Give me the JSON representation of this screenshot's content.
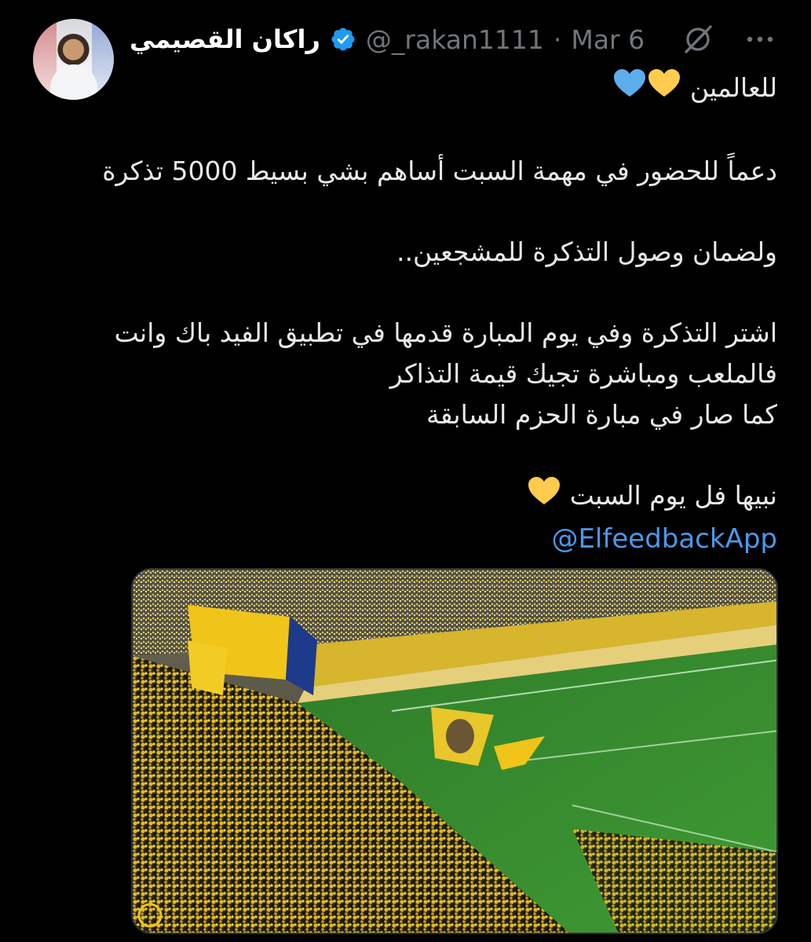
{
  "tweet": {
    "author": {
      "display_name": "راكان القصيمي",
      "handle": "@_rakan1111",
      "verified": true
    },
    "separator": "·",
    "date": "Mar 6",
    "icons": [
      "grok-icon",
      "more-options-icon"
    ],
    "body": {
      "line1": "للعالمين",
      "line1_emojis": [
        "yellow-heart",
        "blue-heart"
      ],
      "line2": "دعماً للحضور في مهمة السبت أساهم بشي بسيط 5000 تذكرة",
      "line3": "ولضمان وصول التذكرة للمشجعين..",
      "line4": "اشتر التذكرة وفي يوم المبارة قدمها في تطبيق الفيد باك وانت",
      "line5": "فالملعب ومباشرة تجيك قيمة التذاكر",
      "line6": "كما صار في مبارة الحزم السابقة",
      "line7": "نبيها فل يوم السبت",
      "line7_emojis": [
        "yellow-heart"
      ],
      "mention": "@ElfeedbackApp"
    },
    "media": {
      "kind": "photo"
    }
  },
  "colors": {
    "background": "#000000",
    "text": "#e7e9ea",
    "muted": "#71767b",
    "link": "#4a99e9",
    "verified": "#1d9bf0",
    "yellow_heart": "#ffcc4d",
    "blue_heart": "#5dadec"
  }
}
